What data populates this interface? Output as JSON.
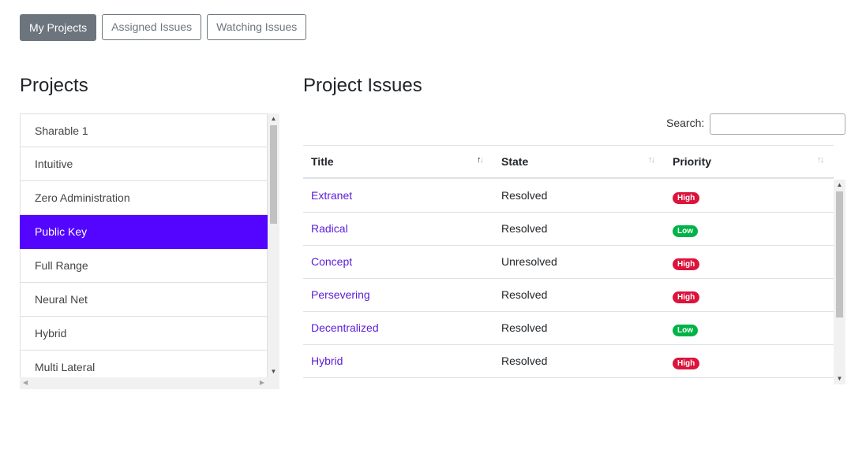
{
  "tabs": [
    {
      "label": "My Projects",
      "active": true
    },
    {
      "label": "Assigned Issues",
      "active": false
    },
    {
      "label": "Watching Issues",
      "active": false
    }
  ],
  "projects": {
    "title": "Projects",
    "items": [
      "Sharable 1",
      "Intuitive",
      "Zero Administration",
      "Public Key",
      "Full Range",
      "Neural Net",
      "Hybrid",
      "Multi Lateral"
    ],
    "selected": "Public Key"
  },
  "issues": {
    "title": "Project Issues",
    "search_label": "Search:",
    "search_value": "",
    "columns": [
      "Title",
      "State",
      "Priority"
    ],
    "rows": [
      {
        "title": "Extranet",
        "state": "Resolved",
        "priority": "High"
      },
      {
        "title": "Radical",
        "state": "Resolved",
        "priority": "Low"
      },
      {
        "title": "Concept",
        "state": "Unresolved",
        "priority": "High"
      },
      {
        "title": "Persevering",
        "state": "Resolved",
        "priority": "High"
      },
      {
        "title": "Decentralized",
        "state": "Resolved",
        "priority": "Low"
      },
      {
        "title": "Hybrid",
        "state": "Resolved",
        "priority": "High"
      }
    ]
  },
  "colors": {
    "selected": "#5305ff",
    "link": "#5a1cd6",
    "high": "#dc143c",
    "low": "#00b347",
    "secondary": "#6c757d"
  },
  "icons": {
    "sort": "sort-icon",
    "scroll_up": "scroll-up-arrow-icon",
    "scroll_down": "scroll-down-arrow-icon"
  }
}
